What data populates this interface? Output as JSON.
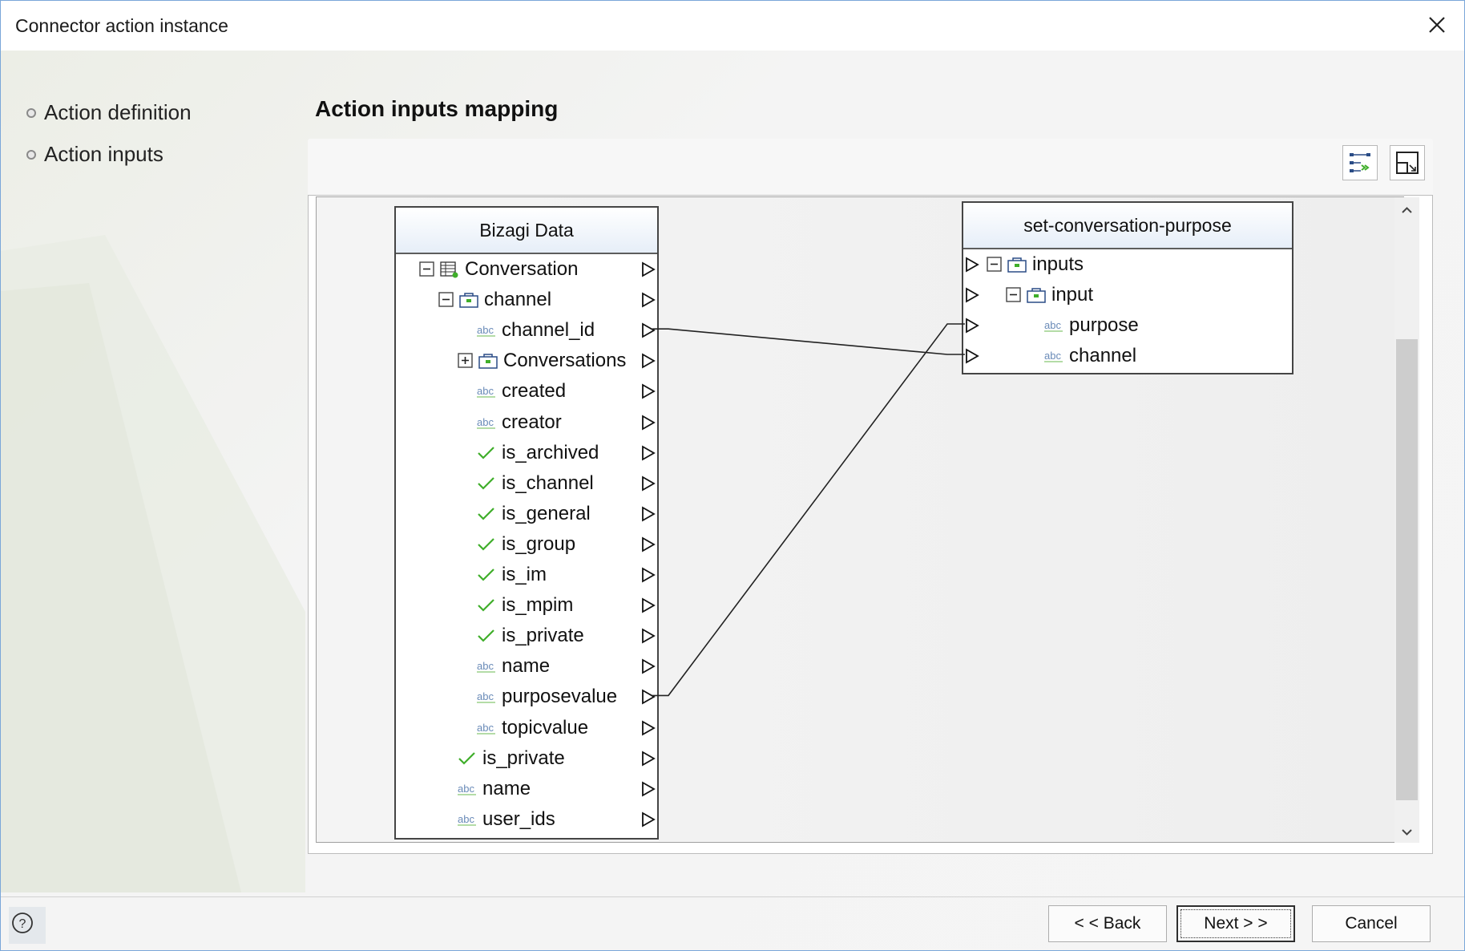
{
  "window": {
    "title": "Connector action instance"
  },
  "steps": [
    {
      "label": "Action definition"
    },
    {
      "label": "Action inputs"
    }
  ],
  "page": {
    "heading": "Action inputs mapping"
  },
  "source_tree": {
    "title": "Bizagi Data",
    "rows": [
      {
        "label": "Conversation",
        "icon": "entity-table-icon",
        "expander": "minus"
      },
      {
        "label": "channel",
        "icon": "object-icon",
        "expander": "minus"
      },
      {
        "label": "channel_id",
        "icon": "string-abc-icon"
      },
      {
        "label": "Conversations",
        "icon": "object-icon",
        "expander": "plus"
      },
      {
        "label": "created",
        "icon": "string-abc-icon"
      },
      {
        "label": "creator",
        "icon": "string-abc-icon"
      },
      {
        "label": "is_archived",
        "icon": "boolean-check-icon"
      },
      {
        "label": "is_channel",
        "icon": "boolean-check-icon"
      },
      {
        "label": "is_general",
        "icon": "boolean-check-icon"
      },
      {
        "label": "is_group",
        "icon": "boolean-check-icon"
      },
      {
        "label": "is_im",
        "icon": "boolean-check-icon"
      },
      {
        "label": "is_mpim",
        "icon": "boolean-check-icon"
      },
      {
        "label": "is_private",
        "icon": "boolean-check-icon"
      },
      {
        "label": "name",
        "icon": "string-abc-icon"
      },
      {
        "label": "purposevalue",
        "icon": "string-abc-icon"
      },
      {
        "label": "topicvalue",
        "icon": "string-abc-icon"
      },
      {
        "label": "is_private",
        "icon": "boolean-check-icon"
      },
      {
        "label": "name",
        "icon": "string-abc-icon"
      },
      {
        "label": "user_ids",
        "icon": "string-abc-icon"
      }
    ]
  },
  "target_tree": {
    "title": "set-conversation-purpose",
    "rows": [
      {
        "label": "inputs",
        "icon": "object-icon",
        "expander": "minus"
      },
      {
        "label": "input",
        "icon": "object-icon",
        "expander": "minus"
      },
      {
        "label": "purpose",
        "icon": "string-abc-icon"
      },
      {
        "label": "channel",
        "icon": "string-abc-icon"
      }
    ]
  },
  "mappings": [
    {
      "from": "channel_id",
      "to": "channel"
    },
    {
      "from": "purposevalue",
      "to": "purpose"
    }
  ],
  "footer": {
    "back_label": "< < Back",
    "next_label": "Next > >",
    "cancel_label": "Cancel"
  },
  "colors": {
    "abc": "#6a8bb8",
    "check": "#3fae2a",
    "accent_border": "#7aa7d9"
  }
}
